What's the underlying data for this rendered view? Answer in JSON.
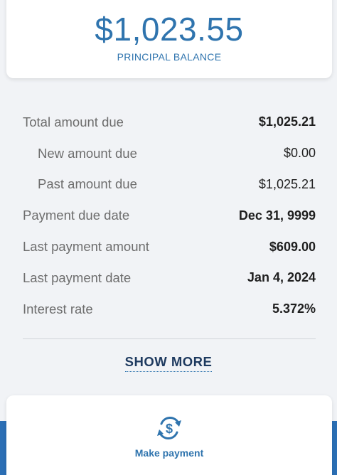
{
  "balance": {
    "amount": "$1,023.55",
    "label": "PRINCIPAL BALANCE"
  },
  "details": {
    "rows": [
      {
        "label": "Total amount due",
        "value": "$1,025.21"
      },
      {
        "label": "New amount due",
        "value": "$0.00"
      },
      {
        "label": "Past amount due",
        "value": "$1,025.21"
      },
      {
        "label": "Payment due date",
        "value": "Dec 31, 9999"
      },
      {
        "label": "Last payment amount",
        "value": "$609.00"
      },
      {
        "label": "Last payment date",
        "value": "Jan 4, 2024"
      },
      {
        "label": "Interest rate",
        "value": "5.372%"
      }
    ]
  },
  "show_more_label": "SHOW MORE",
  "actions": {
    "make_payment": {
      "label": "Make payment",
      "icon": "dollar-refresh-icon"
    }
  },
  "colors": {
    "accent": "#2f74ae",
    "band": "#2b6fb5",
    "background": "#f1f3f6"
  }
}
